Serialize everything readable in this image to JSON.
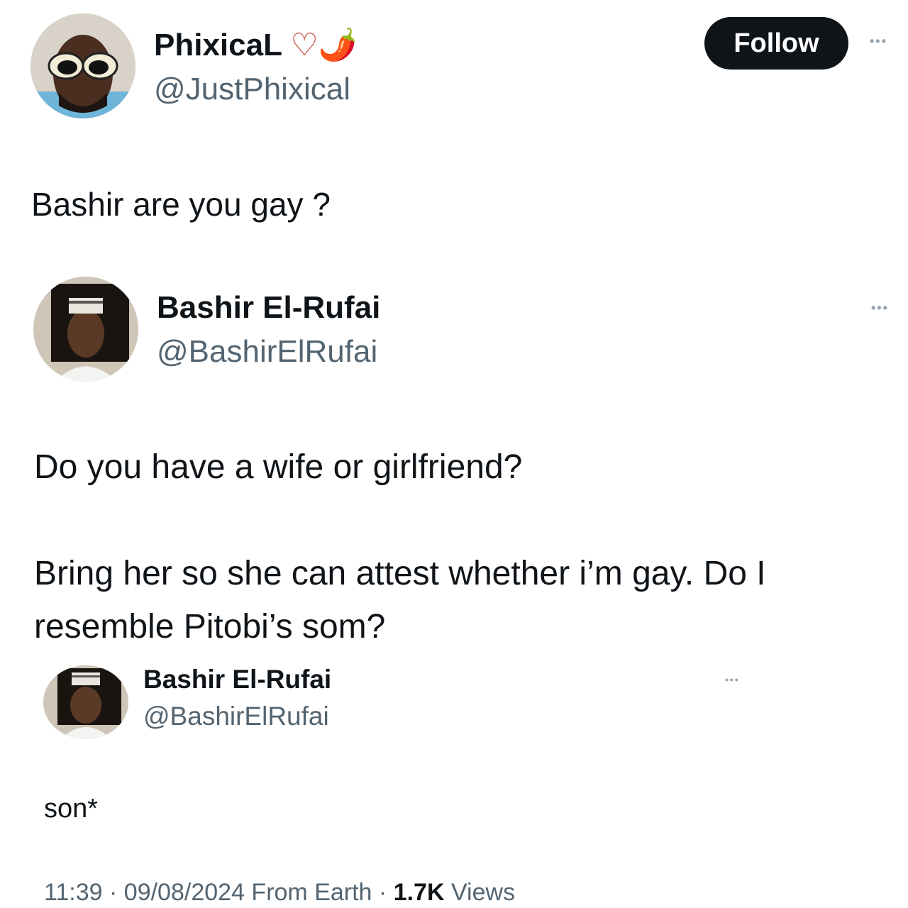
{
  "tweet1": {
    "name": "PhixicaL",
    "name_emoji": "♡🌶️",
    "handle": "@JustPhixical",
    "follow_label": "Follow",
    "more_label": "•••",
    "text": "Bashir are you gay ?"
  },
  "tweet2": {
    "name": "Bashir El-Rufai",
    "handle": "@BashirElRufai",
    "more_label": "•••",
    "text_line1": "Do you have a wife or girlfriend?",
    "text_line2": "Bring her so she can attest whether i’m gay. Do I",
    "text_line3": "resemble Pitobi’s som?"
  },
  "tweet3": {
    "name": "Bashir El-Rufai",
    "handle": "@BashirElRufai",
    "more_label": "•••",
    "text": "son*"
  },
  "meta": {
    "time": "11:39",
    "date": "09/08/2024",
    "source": "From Earth",
    "separator": "·",
    "views_count": "1.7K",
    "views_label": "Views"
  },
  "colors": {
    "text_primary": "#0f1419",
    "text_secondary": "#536471",
    "button_bg": "#0f1419",
    "button_text": "#ffffff"
  }
}
